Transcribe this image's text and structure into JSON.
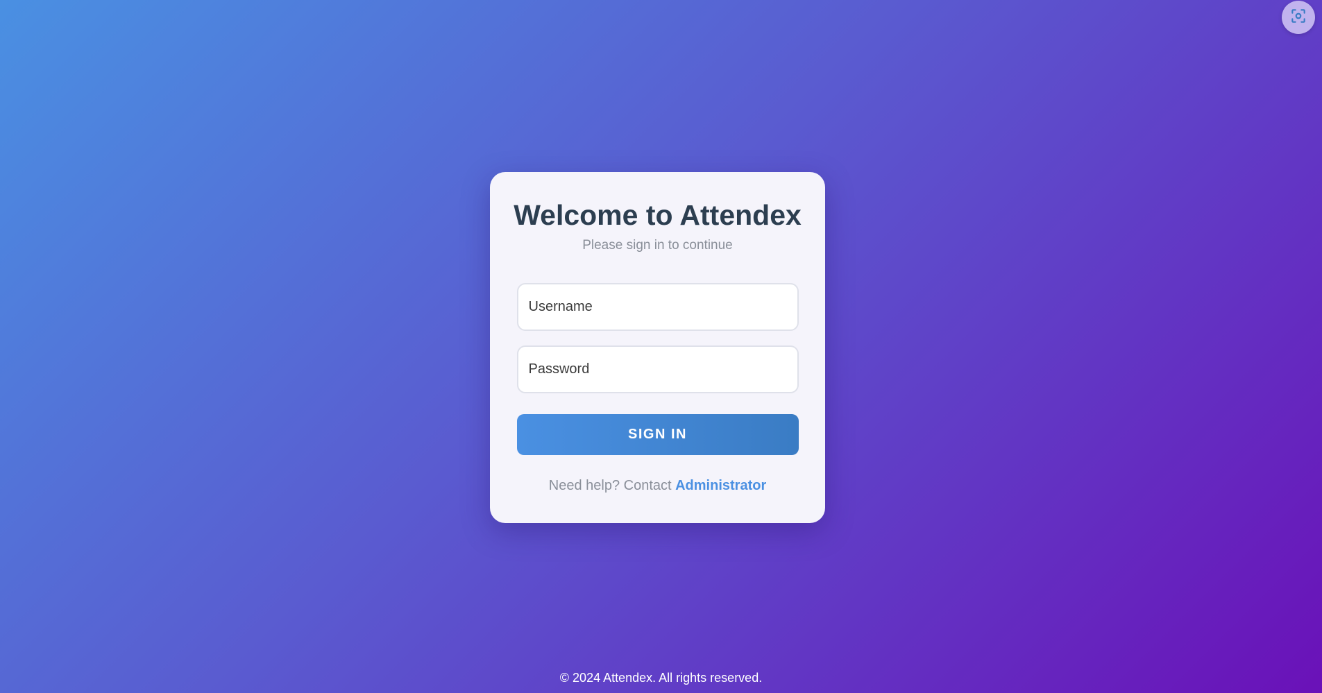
{
  "corner_button": {
    "icon": "screenshot-scan-icon"
  },
  "login": {
    "title": "Welcome to Attendex",
    "subtitle": "Please sign in to continue",
    "username_placeholder": "Username",
    "password_placeholder": "Password",
    "signin_label": "SIGN IN",
    "help_text": "Need help? Contact ",
    "help_link": "Administrator"
  },
  "footer": {
    "text": "© 2024 Attendex. All rights reserved."
  },
  "colors": {
    "gradient_start": "#4a90e2",
    "gradient_end": "#6a11b8",
    "accent": "#4a90e2",
    "title": "#2c3e50"
  }
}
